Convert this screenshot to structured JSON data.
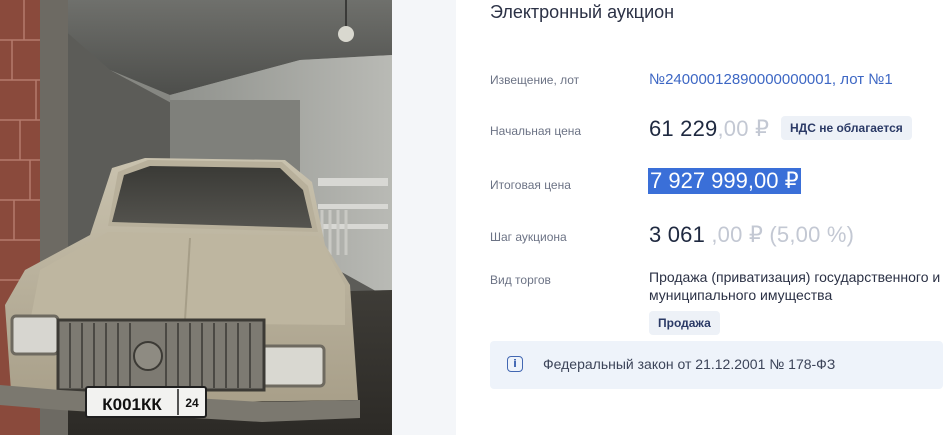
{
  "photo": {
    "plate_number": "К001КК",
    "plate_region": "24"
  },
  "lot": {
    "title": "Электронный аукцион",
    "notice_label": "Извещение, лот",
    "notice_value": "№24000012890000000001, лот №1",
    "start_price_label": "Начальная цена",
    "start_price_main": "61 229",
    "start_price_cents": ",00 ₽",
    "vat_badge": "НДС не облагается",
    "final_price_label": "Итоговая цена",
    "final_price": "7 927 999,00 ₽",
    "step_label": "Шаг аукциона",
    "step_main": "3 061",
    "step_rest": " ,00 ₽ (5,00 %)",
    "trade_type_label": "Вид торгов",
    "trade_type_value": "Продажа (приватизация) государственного и муниципального имущества",
    "trade_badge": "Продажа",
    "law_text": "Федеральный закон от 21.12.2001 № 178-ФЗ"
  },
  "colors": {
    "accent": "#3d67c4",
    "selection": "#3a6fd8",
    "badge_bg": "#edf1f7",
    "notice_bg": "#eef3fa"
  },
  "icons": {
    "notice": "info-icon"
  }
}
